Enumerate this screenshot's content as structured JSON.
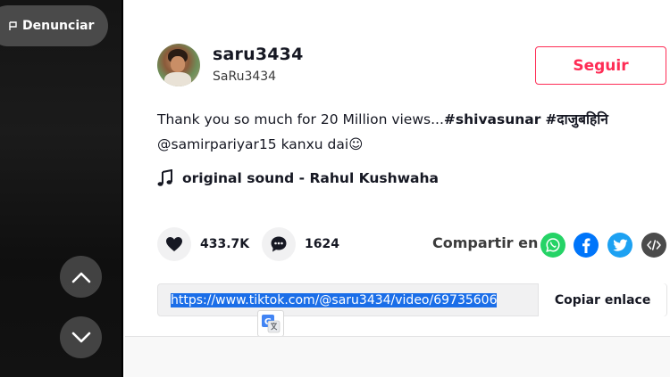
{
  "video_panel": {
    "report_label": "Denunciar"
  },
  "author": {
    "username": "saru3434",
    "nickname": "SaRu3434",
    "follow_label": "Seguir"
  },
  "description": {
    "text": "Thank you so much for 20 Million views...",
    "hashtag_1": "#shivasunar",
    "hashtag_2": "#दाजुबहिनि",
    "mention": "@samirpariyar15",
    "text_2": " kanxu dai☺"
  },
  "music": {
    "label": "original sound - Rahul Kushwaha"
  },
  "actions": {
    "likes": "433.7K",
    "comments": "1624",
    "share_label": "Compartir en"
  },
  "link": {
    "url": "https://www.tiktok.com/@saru3434/video/69735606",
    "copy_label": "Copiar enlace"
  },
  "colors": {
    "accent": "#fe2c55",
    "whatsapp": "#25d366",
    "facebook": "#0075fa",
    "twitter": "#1da1f2"
  },
  "icons": [
    "flag-icon",
    "chevron-up-icon",
    "chevron-down-icon",
    "music-note-icon",
    "heart-icon",
    "comment-icon",
    "whatsapp-icon",
    "facebook-icon",
    "twitter-icon",
    "embed-icon",
    "translate-icon"
  ]
}
